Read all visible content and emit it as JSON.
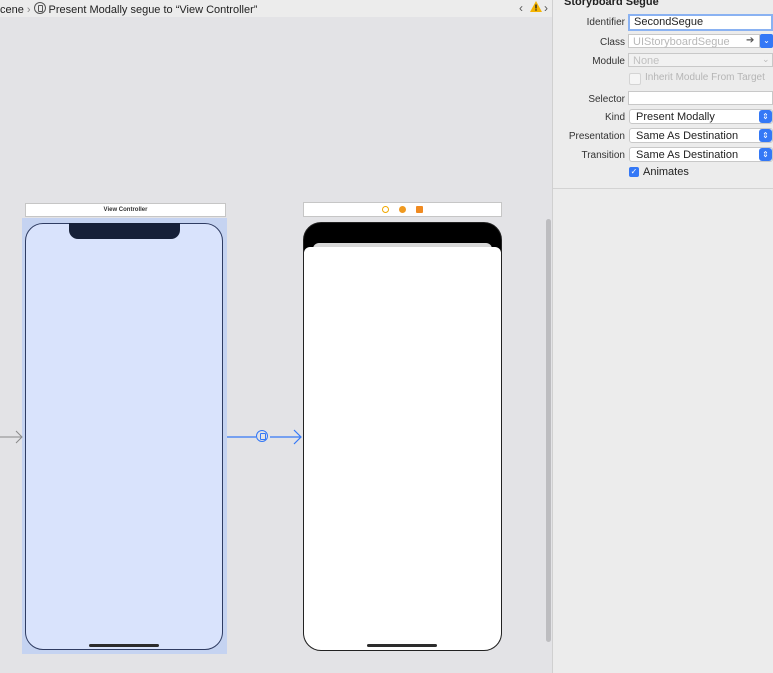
{
  "jumpbar": {
    "scene_fragment": "cene",
    "segue_label": "Present Modally segue to “View Controller”",
    "nav_left": "‹",
    "nav_right": "›",
    "warning_icon": "warning-triangle"
  },
  "canvas": {
    "source_scene_title": "View Controller",
    "accent": "#3478f6"
  },
  "inspector": {
    "title": "Storyboard Segue",
    "identifier_label": "Identifier",
    "identifier_value": "SecondSegue",
    "class_label": "Class",
    "class_placeholder": "UIStoryboardSegue",
    "module_label": "Module",
    "module_value": "None",
    "inherit_label": "Inherit Module From Target",
    "inherit_checked": false,
    "selector_label": "Selector",
    "selector_value": "",
    "kind_label": "Kind",
    "kind_value": "Present Modally",
    "presentation_label": "Presentation",
    "presentation_value": "Same As Destination",
    "transition_label": "Transition",
    "transition_value": "Same As Destination",
    "animates_label": "Animates",
    "animates_checked": true
  }
}
